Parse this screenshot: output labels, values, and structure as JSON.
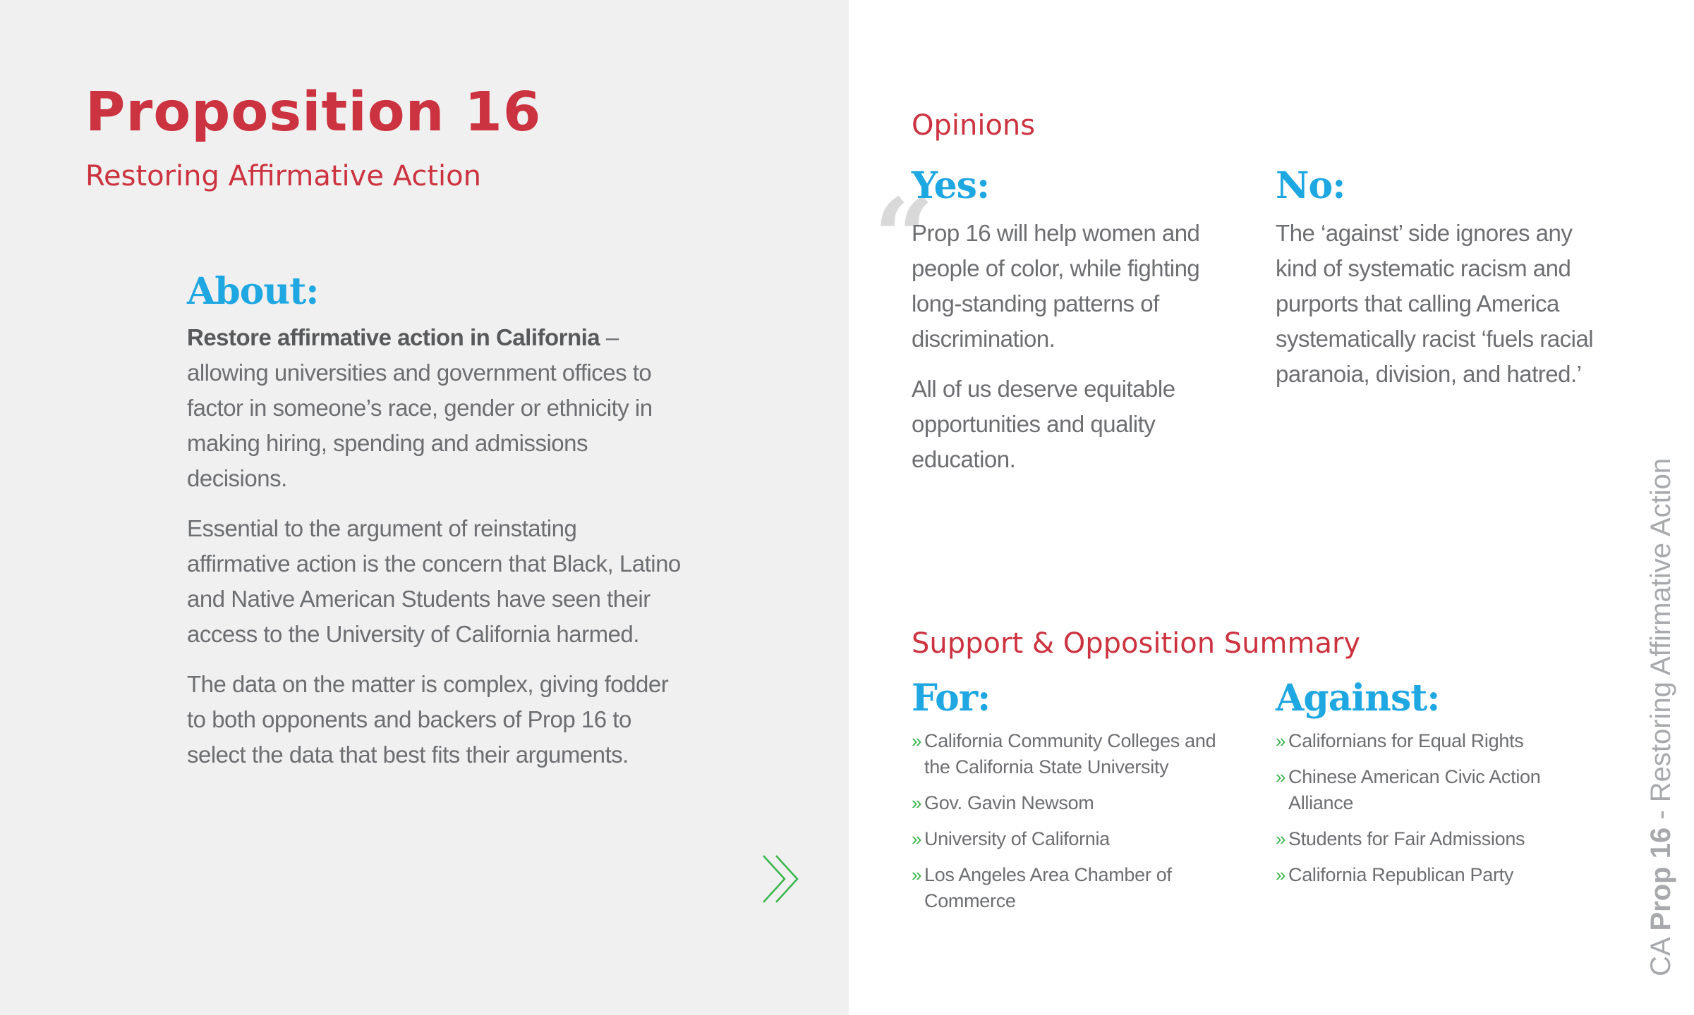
{
  "header": {
    "title": "Proposition 16",
    "subtitle": "Restoring Affirmative Action"
  },
  "about": {
    "heading": "About:",
    "lead_bold": "Restore affirmative action in California",
    "lead_rest": " – allowing universities and government offices to factor in someone’s race, gender or ethnicity in making hiring, spending and admissions decisions.",
    "paragraphs": [
      "Essential to the argument of reinstating affirmative action is the concern that Black, Latino and Native American Students have seen their access to the University of California harmed.",
      "The data on the matter is complex, giving fodder to both opponents and backers of Prop 16 to select the data that best fits their arguments."
    ]
  },
  "opinions": {
    "title": "Opinions",
    "quote_mark": "“",
    "yes": {
      "heading": "Yes:",
      "paragraphs": [
        "Prop 16 will help women and people of color, while fighting long-standing patterns of discrimination.",
        "All of us deserve equitable opportunities and quality education."
      ]
    },
    "no": {
      "heading": "No:",
      "paragraphs": [
        "The ‘against’ side ignores any kind of systematic racism and purports that calling America systematically racist ‘fuels racial paranoia, division, and hatred.’"
      ]
    }
  },
  "summary": {
    "title": "Support & Opposition Summary",
    "bullet": "»",
    "for": {
      "heading": "For:",
      "items": [
        "California Community Colleges and the California State University",
        "Gov. Gavin Newsom",
        "University of California",
        "Los Angeles Area Chamber of Commerce"
      ]
    },
    "against": {
      "heading": "Against:",
      "items": [
        "Californians for Equal Rights",
        "Chinese American Civic Action Alliance",
        "Students for Fair Admissions",
        "California Republican Party"
      ]
    }
  },
  "side_label": {
    "state": "CA",
    "prop": "Prop 16",
    "rest": " - Restoring Affirmative Action"
  },
  "icons": {
    "next": "double-chevron-right-icon",
    "quote": "quote-mark-icon"
  },
  "colors": {
    "accent_red": "#cc3340",
    "accent_blue": "#1ea7e1",
    "accent_green": "#39b54a",
    "body_gray": "#6d6e71",
    "panel_gray": "#f0f0f0"
  }
}
